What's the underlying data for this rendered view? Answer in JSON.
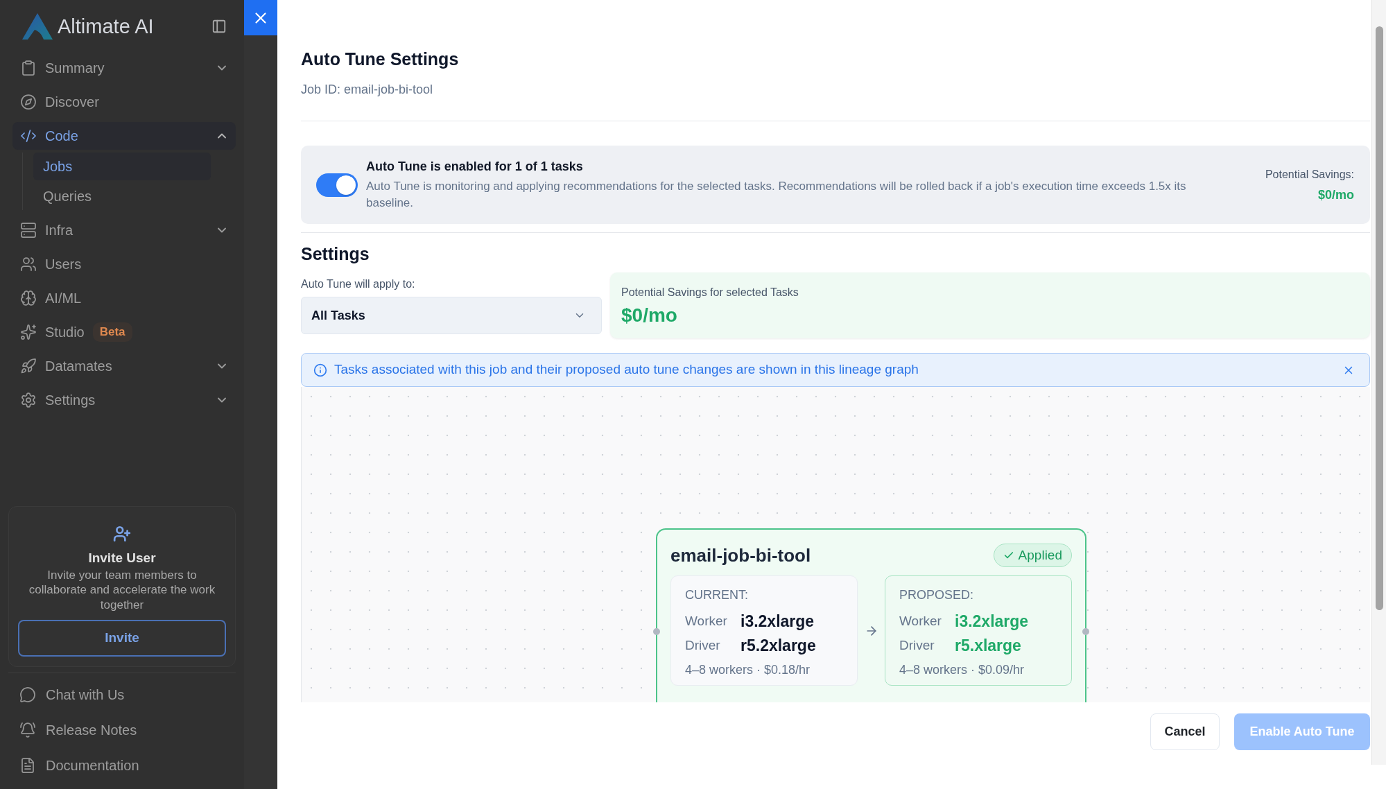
{
  "sidebar": {
    "brand": "Altimate AI",
    "nav": [
      {
        "label": "Summary",
        "kind": "group",
        "expanded": false,
        "selected": false
      },
      {
        "label": "Discover",
        "kind": "link",
        "selected": false
      },
      {
        "label": "Code",
        "kind": "group",
        "expanded": true,
        "selected": true,
        "children": [
          {
            "label": "Jobs",
            "selected": true
          },
          {
            "label": "Queries",
            "selected": false
          }
        ]
      },
      {
        "label": "Infra",
        "kind": "group",
        "expanded": false,
        "selected": false
      },
      {
        "label": "Users",
        "kind": "link",
        "selected": false
      },
      {
        "label": "AI/ML",
        "kind": "link",
        "selected": false
      },
      {
        "label": "Studio",
        "kind": "link",
        "selected": false,
        "badge": "Beta"
      },
      {
        "label": "Datamates",
        "kind": "group",
        "expanded": false,
        "selected": false
      },
      {
        "label": "Settings",
        "kind": "group",
        "expanded": false,
        "selected": false
      }
    ],
    "invite": {
      "title": "Invite User",
      "description": "Invite your team members to collaborate and accelerate the work together",
      "button": "Invite"
    },
    "links": [
      "Chat with Us",
      "Release Notes",
      "Documentation"
    ]
  },
  "panel": {
    "title": "Auto Tune Settings",
    "subtitle": "Job ID: email-job-bi-tool",
    "auto_tune": {
      "on": true,
      "title": "Auto Tune is enabled for 1 of 1 tasks",
      "description": "Auto Tune is monitoring and applying recommendations for the selected tasks. Recommendations will be rolled back if a job's execution time exceeds 1.5x its baseline.",
      "savings_label": "Potential Savings:",
      "savings_value": "$0/mo"
    },
    "settings": {
      "heading": "Settings",
      "scope_label": "Auto Tune will apply to:",
      "scope_value": "All Tasks",
      "savings_label": "Potential Savings for selected Tasks",
      "savings_value": "$0/mo"
    },
    "notice": {
      "text": "Tasks associated with this job and their proposed auto tune changes are shown in this lineage graph"
    },
    "lineage": {
      "nodes": [
        {
          "title": "email-job-bi-tool",
          "status": "Applied",
          "configs": [
            {
              "kind": "current",
              "heading": "CURRENT:",
              "rows": [
                {
                  "label": "Worker",
                  "value": "i3.2xlarge"
                },
                {
                  "label": "Driver",
                  "value": "r5.2xlarge"
                }
              ],
              "summary": "4–8 workers · $0.18/hr"
            },
            {
              "kind": "proposed",
              "heading": "PROPOSED:",
              "rows": [
                {
                  "label": "Worker",
                  "value": "i3.2xlarge"
                },
                {
                  "label": "Driver",
                  "value": "r5.xlarge"
                }
              ],
              "summary": "4–8 workers · $0.09/hr"
            }
          ]
        }
      ]
    }
  },
  "footer": {
    "buttons": [
      {
        "label": "Cancel",
        "kind": "secondary",
        "disabled": false
      },
      {
        "label": "Enable Auto Tune",
        "kind": "primary",
        "disabled": true
      }
    ]
  }
}
